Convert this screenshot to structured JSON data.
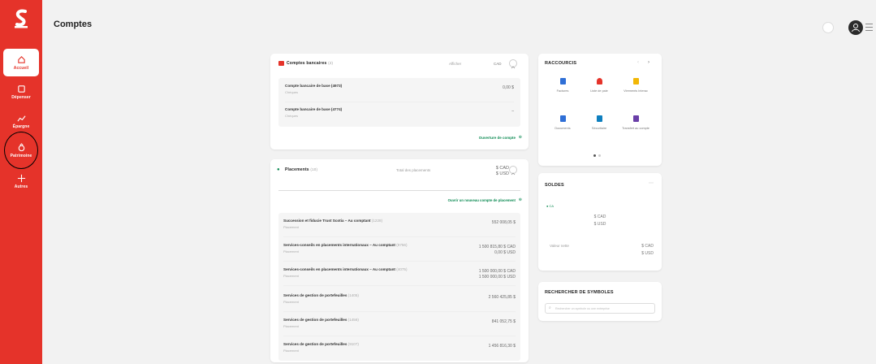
{
  "header": {
    "title": "Comptes"
  },
  "sidebar": {
    "items": [
      {
        "label": "Accueil"
      },
      {
        "label": "Dépenser"
      },
      {
        "label": "Épargne"
      },
      {
        "label": "Patrimoine"
      },
      {
        "label": "Autres"
      }
    ]
  },
  "bank_accounts": {
    "title": "Comptes bancaires",
    "count": "(2)",
    "currency_label": "CAD",
    "filter_label": "Afficher",
    "accounts": [
      {
        "name": "Compte bancaire de base (4973)",
        "type": "Chèques",
        "amount": "0,00 $"
      },
      {
        "name": "Compte bancaire de base (4774)",
        "type": "Chèques",
        "amount": "–"
      }
    ],
    "open_account_link": "Ouverture de compte"
  },
  "investments": {
    "title": "Placements",
    "count": "(10)",
    "total_label": "Total des placements",
    "total_cad": "$ CAD",
    "total_usd": "$ USD",
    "open_account_link": "Ouvrir un nouveau compte de placement",
    "accounts": [
      {
        "name": "Succession et fiducie Trust Scotia – Au comptant",
        "num": "(1228)",
        "type": "Placement",
        "amount1": "552 008,05 $",
        "amount2": ""
      },
      {
        "name": "Services-conseils en placements internationaux – Au comptant",
        "num": "(9756)",
        "type": "Placement",
        "amount1": "1 500 815,80 $ CAD",
        "amount2": "0,00 $ USD"
      },
      {
        "name": "Services-conseils en placements internationaux – Au comptant",
        "num": "(4075)",
        "type": "Placement",
        "amount1": "1 500 000,00 $ CAD",
        "amount2": "1 500 000,00 $ USD"
      },
      {
        "name": "Services de gestion de portefeuilles",
        "num": "(1405)",
        "type": "Placement",
        "amount1": "2 560 425,85 $",
        "amount2": ""
      },
      {
        "name": "Services de gestion de portefeuilles",
        "num": "(1456)",
        "type": "Placement",
        "amount1": "841 052,75 $",
        "amount2": ""
      },
      {
        "name": "Services de gestion de portefeuilles",
        "num": "(9107)",
        "type": "Placement",
        "amount1": "1 456 816,30 $",
        "amount2": ""
      }
    ]
  },
  "shortcuts": {
    "title": "RACCOURCIS",
    "items": [
      {
        "label": "Factures",
        "color": "#2f6fd6"
      },
      {
        "label": "Liste de paie",
        "color": "#e5332a"
      },
      {
        "label": "Virements Interac",
        "color": "#f2b705"
      },
      {
        "label": "Documents",
        "color": "#2f6fd6"
      },
      {
        "label": "Sécuritaire",
        "color": "#0e7fbf"
      },
      {
        "label": "Transfert au compte",
        "color": "#6a3fa8"
      }
    ]
  },
  "balances": {
    "title": "SOLDES",
    "legend": "CA",
    "cad": "$ CAD",
    "usd": "$ USD",
    "row_label": "Valeur nette",
    "row_cad": "$ CAD",
    "row_usd": "$ USD"
  },
  "symbols": {
    "title": "RECHERCHER DE SYMBOLES",
    "placeholder": "Rechercher un symbole ou une entreprise"
  },
  "colors": {
    "brand": "#e5332a",
    "accent_green": "#0b8a52"
  }
}
